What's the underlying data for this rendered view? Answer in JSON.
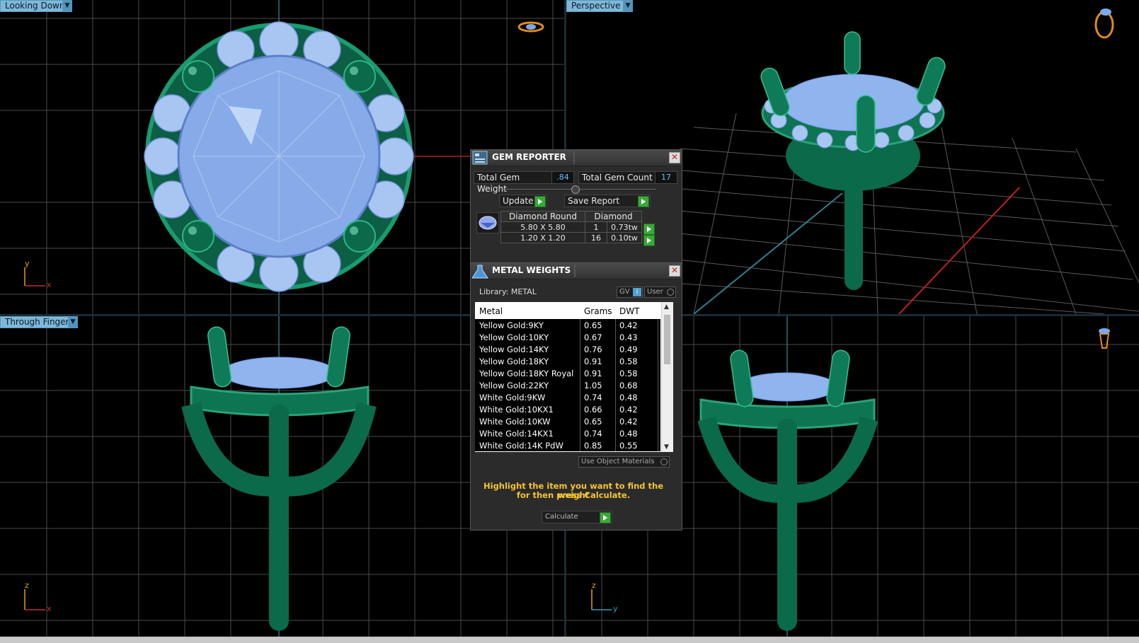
{
  "viewports": {
    "top_left": {
      "label": "Looking Down",
      "axis_a": "y",
      "axis_b": "x"
    },
    "top_right": {
      "label": "Perspective"
    },
    "bottom_left": {
      "label": "Through Finger",
      "axis_a": "z",
      "axis_b": "x"
    },
    "bottom_right": {
      "axis_a": "z",
      "axis_b": "y"
    }
  },
  "gem_reporter": {
    "title": "GEM REPORTER",
    "total_weight_label": "Total Gem Weight",
    "total_weight_value": ".84",
    "total_count_label": "Total Gem Count",
    "total_count_value": "17",
    "update_label": "Update",
    "save_report_label": "Save Report",
    "table": {
      "headers": [
        "Diamond Round",
        "Diamond"
      ],
      "rows": [
        {
          "size": "5.80 X 5.80",
          "count": "1",
          "weight": "0.73tw"
        },
        {
          "size": "1.20 X 1.20",
          "count": "16",
          "weight": "0.10tw"
        }
      ]
    }
  },
  "metal_weights": {
    "title": "METAL WEIGHTS",
    "library_label": "Library: METAL",
    "gv_label": "GV",
    "user_label": "User",
    "columns": [
      "Metal",
      "Grams",
      "DWT"
    ],
    "rows": [
      {
        "metal": "Yellow Gold:9KY",
        "grams": "0.65",
        "dwt": "0.42"
      },
      {
        "metal": "Yellow Gold:10KY",
        "grams": "0.67",
        "dwt": "0.43"
      },
      {
        "metal": "Yellow Gold:14KY",
        "grams": "0.76",
        "dwt": "0.49"
      },
      {
        "metal": "Yellow Gold:18KY",
        "grams": "0.91",
        "dwt": "0.58"
      },
      {
        "metal": "Yellow Gold:18KY Royal",
        "grams": "0.91",
        "dwt": "0.58"
      },
      {
        "metal": "Yellow Gold:22KY",
        "grams": "1.05",
        "dwt": "0.68"
      },
      {
        "metal": "White Gold:9KW",
        "grams": "0.74",
        "dwt": "0.48"
      },
      {
        "metal": "White Gold:10KX1",
        "grams": "0.66",
        "dwt": "0.42"
      },
      {
        "metal": "White Gold:10KW",
        "grams": "0.65",
        "dwt": "0.42"
      },
      {
        "metal": "White Gold:14KX1",
        "grams": "0.74",
        "dwt": "0.48"
      },
      {
        "metal": "White Gold:14K PdW",
        "grams": "0.85",
        "dwt": "0.55"
      }
    ],
    "use_object_materials_label": "Use Object Materials",
    "hint_line1": "Highlight the item you want to find the weight",
    "hint_line2": "for then press Calculate.",
    "calculate_label": "Calculate"
  },
  "colors": {
    "metal_green": "#0f7a58",
    "gem_blue": "#8fb4ee",
    "grid": "#5a5a5a",
    "hint_yellow": "#f5c330"
  }
}
